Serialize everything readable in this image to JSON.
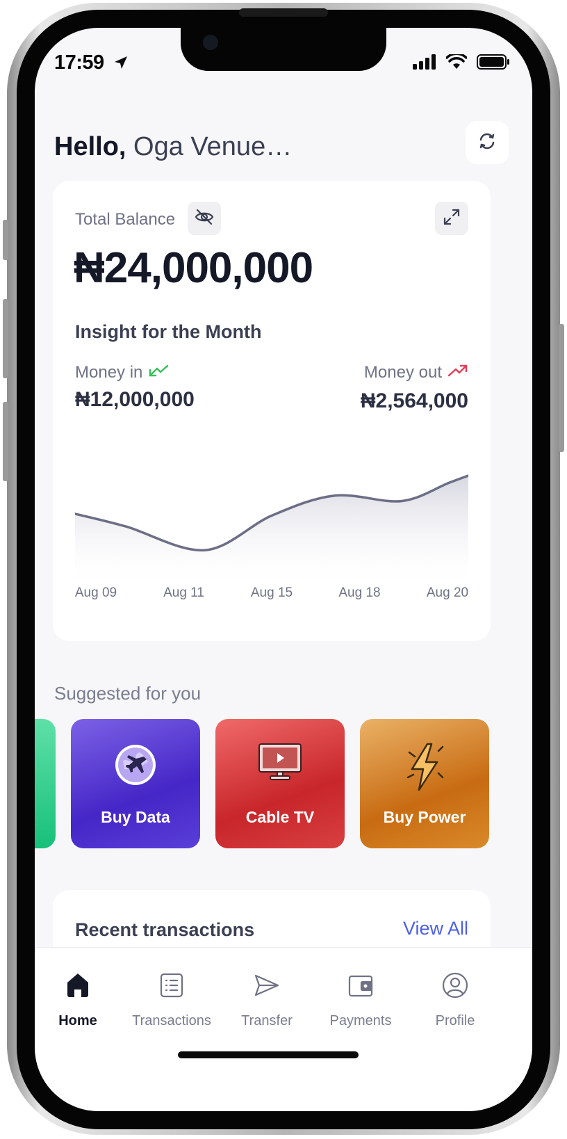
{
  "status_bar": {
    "time": "17:59"
  },
  "greeting": {
    "hello": "Hello,",
    "name": "Oga Venue…"
  },
  "balance": {
    "label": "Total Balance",
    "amount": "₦24,000,000"
  },
  "insight": {
    "title": "Insight for the Month",
    "money_in_label": "Money in",
    "money_in_value": "₦12,000,000",
    "money_out_label": "Money out",
    "money_out_value": "₦2,564,000",
    "colors": {
      "in": "#3bbf5c",
      "out": "#e2405b",
      "line": "#6b6e85"
    }
  },
  "chart_data": {
    "type": "area",
    "categories": [
      "Aug 09",
      "Aug 11",
      "Aug 15",
      "Aug 18",
      "Aug 20"
    ],
    "x": [
      0,
      0.13,
      0.33,
      0.5,
      0.66,
      0.83,
      0.95,
      1.0
    ],
    "values": [
      62,
      48,
      22,
      60,
      82,
      76,
      96,
      104
    ],
    "ylim": [
      0,
      130
    ],
    "grid": false,
    "legend": "none"
  },
  "suggested": {
    "title": "Suggested for you",
    "items": [
      {
        "label": "Buy Data",
        "icon": "globe-plane-icon"
      },
      {
        "label": "Cable TV",
        "icon": "tv-icon"
      },
      {
        "label": "Buy Power",
        "icon": "lightning-icon"
      }
    ]
  },
  "recent": {
    "title": "Recent transactions",
    "view_all": "View All"
  },
  "tabs": [
    {
      "label": "Home",
      "icon": "home-icon",
      "active": true
    },
    {
      "label": "Transactions",
      "icon": "list-icon"
    },
    {
      "label": "Transfer",
      "icon": "send-icon"
    },
    {
      "label": "Payments",
      "icon": "wallet-icon"
    },
    {
      "label": "Profile",
      "icon": "user-icon"
    }
  ]
}
